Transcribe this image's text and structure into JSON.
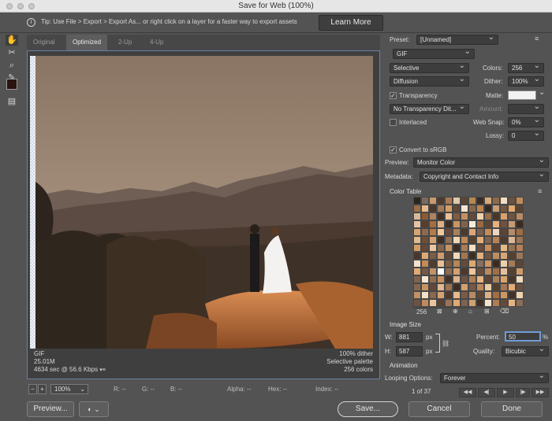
{
  "window": {
    "title": "Save for Web (100%)"
  },
  "tip": {
    "text": "Tip: Use File > Export > Export As...   or right click on a layer for a faster way to export assets",
    "learn_more": "Learn More"
  },
  "tools": [
    {
      "name": "hand-tool-icon",
      "glyph": "✋"
    },
    {
      "name": "slice-select-tool-icon",
      "glyph": "✂"
    },
    {
      "name": "zoom-tool-icon",
      "glyph": "⌕"
    },
    {
      "name": "eyedropper-tool-icon",
      "glyph": "✎"
    },
    {
      "name": "eyedropper-color-swatch",
      "glyph": ""
    },
    {
      "name": "toggle-slices-icon",
      "glyph": "▤"
    }
  ],
  "tabs": [
    "Original",
    "Optimized",
    "2-Up",
    "4-Up"
  ],
  "preview_info": {
    "format": "GIF",
    "size": "25.01M",
    "time": "4634 sec @ 56.6 Kbps",
    "dither": "100% dither",
    "palette": "Selective palette",
    "colors": "256 colors"
  },
  "status": {
    "zoom": "100%",
    "r": "R: --",
    "g": "G: --",
    "b": "B: --",
    "alpha": "Alpha: --",
    "hex": "Hex: --",
    "index": "Index: --"
  },
  "buttons": {
    "preview": "Preview...",
    "save": "Save...",
    "cancel": "Cancel",
    "done": "Done"
  },
  "settings": {
    "preset_label": "Preset:",
    "preset_value": "[Unnamed]",
    "format": "GIF",
    "reduction": "Selective",
    "dither_algo": "Diffusion",
    "colors_label": "Colors:",
    "colors_value": "256",
    "dither_label": "Dither:",
    "dither_value": "100%",
    "transparency": "Transparency",
    "matte_label": "Matte:",
    "transparency_dither": "No Transparency Dit...",
    "amount_label": "Amount:",
    "interlaced": "Interlaced",
    "web_snap_label": "Web Snap:",
    "web_snap_value": "0%",
    "lossy_label": "Lossy:",
    "lossy_value": "0",
    "convert_srgb": "Convert to sRGB",
    "preview_label": "Preview:",
    "preview_value": "Monitor Color",
    "metadata_label": "Metadata:",
    "metadata_value": "Copyright and Contact Info",
    "color_table_title": "Color Table",
    "color_count": "256"
  },
  "image_size": {
    "title": "Image Size",
    "w_label": "W:",
    "w_value": "881",
    "h_label": "H:",
    "h_value": "587",
    "px": "px",
    "percent_label": "Percent:",
    "percent_value": "50",
    "percent_unit": "%",
    "quality_label": "Quality:",
    "quality_value": "Bicubic"
  },
  "animation": {
    "title": "Animation",
    "looping_label": "Looping Options:",
    "looping_value": "Forever",
    "frame_counter": "1 of 37"
  },
  "colors": {
    "accent": "#6b7fa8",
    "panel_bg": "#535353",
    "matte_swatch": "#f2f2f2"
  },
  "color_table": [
    "#2b2520",
    "#7a6a5e",
    "#c89a6e",
    "#4d3b2e",
    "#a87850",
    "#e0c8a8",
    "#5a4636",
    "#b5884f",
    "#3a2d24",
    "#d8aa7a",
    "#8f6a4a",
    "#f2dcc2",
    "#6a5240",
    "#c08a58",
    "#9c6e46",
    "#e8b98c",
    "#4a382c",
    "#a07a5c",
    "#d29c66",
    "#5e4838",
    "#f4e6d4",
    "#87664c",
    "#bd8450",
    "#34291f",
    "#c9a07a",
    "#735642",
    "#e2a86c",
    "#5b4232",
    "#d6b89a",
    "#8a5c34",
    "#b08262",
    "#3f3027",
    "#eac29a",
    "#7d5c40",
    "#c59064",
    "#624a3a",
    "#f0d2ac",
    "#96704e",
    "#4a3628",
    "#d9a06a",
    "#6e5444",
    "#b98c66",
    "#e4c4a4",
    "#573f2e",
    "#a56e40",
    "#dcb088",
    "#3c2e25",
    "#cc9460",
    "#80624c",
    "#f6ecdc",
    "#9a6a40",
    "#5f4535",
    "#e8b07a",
    "#715242",
    "#c49a74",
    "#3a2a1f",
    "#d8a470",
    "#8c6a52",
    "#b27c4c",
    "#f0c89e",
    "#65493a",
    "#a8805e",
    "#4c3a2d",
    "#dca67a",
    "#786050",
    "#c48c58",
    "#ecd8bf",
    "#5c4434",
    "#b58a68",
    "#a06c42",
    "#e0ba90",
    "#6c4e3a",
    "#d2a272",
    "#3e2f26",
    "#8e6e56",
    "#f2d6b4",
    "#c0885a",
    "#56402f",
    "#e4ae78",
    "#7e624e",
    "#b88256",
    "#4e3b2f",
    "#ddb696",
    "#9e7452",
    "#d49c64",
    "#64483a",
    "#eac6a0",
    "#83654f",
    "#c89464",
    "#3b2c22",
    "#a77c58",
    "#f4dec4",
    "#6a4c3a",
    "#c78e5c",
    "#5a4232",
    "#e6b886",
    "#927252",
    "#b4805a",
    "#4a372b",
    "#deaa74",
    "#7a5e4a",
    "#ce9c70",
    "#5e4636",
    "#f0d8ba",
    "#a37650",
    "#3d2e24",
    "#e2b080",
    "#6e5444",
    "#bc8c62",
    "#d6a676",
    "#55402f",
    "#9a7658",
    "#f2e2cc",
    "#c28a56",
    "#4f3c2e",
    "#e8be94",
    "#7c5c44",
    "#b48658",
    "#654a3a",
    "#daa870",
    "#877060",
    "#cc9666",
    "#3a2b21",
    "#ecd0ac",
    "#a47a56",
    "#5c4434",
    "#e0aa72",
    "#74584a",
    "#c0926a",
    "#ffffff",
    "#8b6b50",
    "#d4a070",
    "#4c392c",
    "#f0c49a",
    "#6a4e3c",
    "#b98a60",
    "#a06e48",
    "#e6c09e",
    "#574030",
    "#cf9a68",
    "#7e6450",
    "#f6e8d6",
    "#936e4e",
    "#c48e5e",
    "#413128",
    "#deb48c",
    "#6d5242",
    "#b27e54",
    "#e8b482",
    "#5a4435",
    "#a9805e",
    "#d8a46c",
    "#4a3629",
    "#f2dabe",
    "#876650",
    "#c69462",
    "#61483a",
    "#e0b894",
    "#9c7250",
    "#3c2d24",
    "#d2a070",
    "#755848",
    "#bc885a",
    "#eccca4",
    "#52402f",
    "#a47854",
    "#e4ac76",
    "#6a5040",
    "#c29068",
    "#f4e0c8",
    "#8a684e",
    "#d6a270",
    "#4e3a2c",
    "#e8ba8c",
    "#7a5c46",
    "#b68a64",
    "#5e4636",
    "#dcb08a",
    "#a26e44",
    "#cc9864",
    "#433228",
    "#f0d4b0",
    "#6e5242",
    "#c08a5e",
    "#eac4a0",
    "#574232",
    "#9a7454",
    "#e2a872",
    "#7e6250",
    "#d0a074",
    "#3f3026",
    "#f2e4d0",
    "#b07c52",
    "#644a3a",
    "#e6b484",
    "#8e6e56",
    "#c89262",
    "#4b382c",
    "#deac7c",
    "#72584a",
    "#ba8c66",
    "#f0ceaa",
    "#5a4334",
    "#a67c5a",
    "#d8a674",
    "#ffffff"
  ]
}
